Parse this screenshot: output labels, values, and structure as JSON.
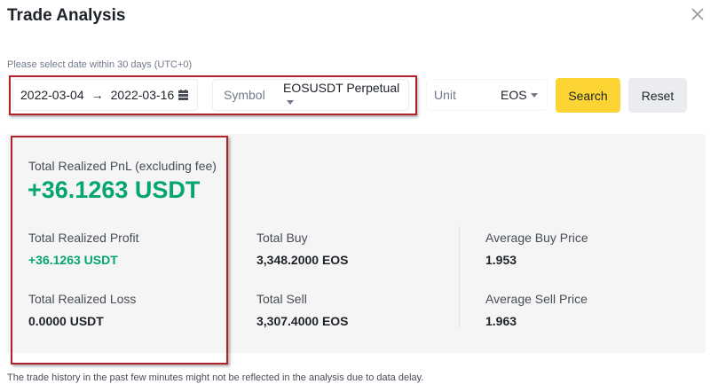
{
  "dialog": {
    "title": "Trade Analysis",
    "close_icon": "close-icon",
    "hint": "Please select date within 30 days (UTC+0)"
  },
  "filters": {
    "start_date": "2022-03-04",
    "arrow": "→",
    "end_date": "2022-03-16",
    "calendar_icon": "calendar-icon",
    "symbol_label": "Symbol",
    "symbol_value": "EOSUSDT Perpetual",
    "unit_label": "Unit",
    "unit_value": "EOS",
    "search_label": "Search",
    "reset_label": "Reset"
  },
  "summary": {
    "pnl_label": "Total Realized PnL (excluding fee)",
    "pnl_value": "+36.1263 USDT",
    "profit_label": "Total Realized Profit",
    "profit_value": "+36.1263 USDT",
    "loss_label": "Total Realized Loss",
    "loss_value": "0.0000 USDT",
    "buy_label": "Total Buy",
    "buy_value": "3,348.2000 EOS",
    "sell_label": "Total Sell",
    "sell_value": "3,307.4000 EOS",
    "avg_buy_label": "Average Buy Price",
    "avg_buy_value": "1.953",
    "avg_sell_label": "Average Sell Price",
    "avg_sell_value": "1.963"
  },
  "footnote": "The trade history in the past few minutes might not be reflected in the analysis due to data delay.",
  "colors": {
    "accent": "#fcd535",
    "positive": "#03a66d",
    "highlight": "#b02128"
  }
}
